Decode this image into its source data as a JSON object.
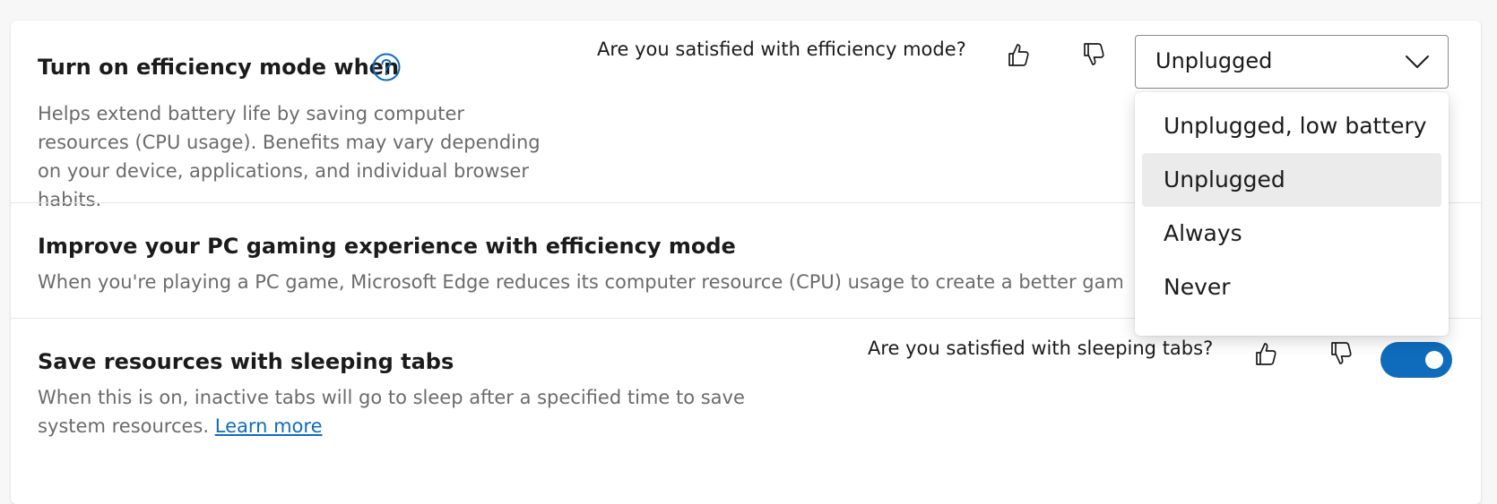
{
  "efficiency": {
    "title": "Turn on efficiency mode when",
    "description": "Helps extend battery life by saving computer resources (CPU usage). Benefits may vary depending on your device, applications, and individual browser habits.",
    "feedback_question": "Are you satisfied with efficiency mode?",
    "select_value": "Unplugged",
    "options": [
      "Unplugged, low battery",
      "Unplugged",
      "Always",
      "Never"
    ],
    "selected_index": 1
  },
  "gaming": {
    "title": "Improve your PC gaming experience with efficiency mode",
    "description": "When you're playing a PC game, Microsoft Edge reduces its computer resource (CPU) usage to create a better gaming experience."
  },
  "sleeping_tabs": {
    "title": "Save resources with sleeping tabs",
    "description": "When this is on, inactive tabs will go to sleep after a specified time to save system resources.",
    "learn_more": "Learn more",
    "feedback_question": "Are you satisfied with sleeping tabs?",
    "toggle_on": true
  },
  "colors": {
    "accent": "#0f6cbd",
    "selected_option_bg": "#ebebeb"
  }
}
